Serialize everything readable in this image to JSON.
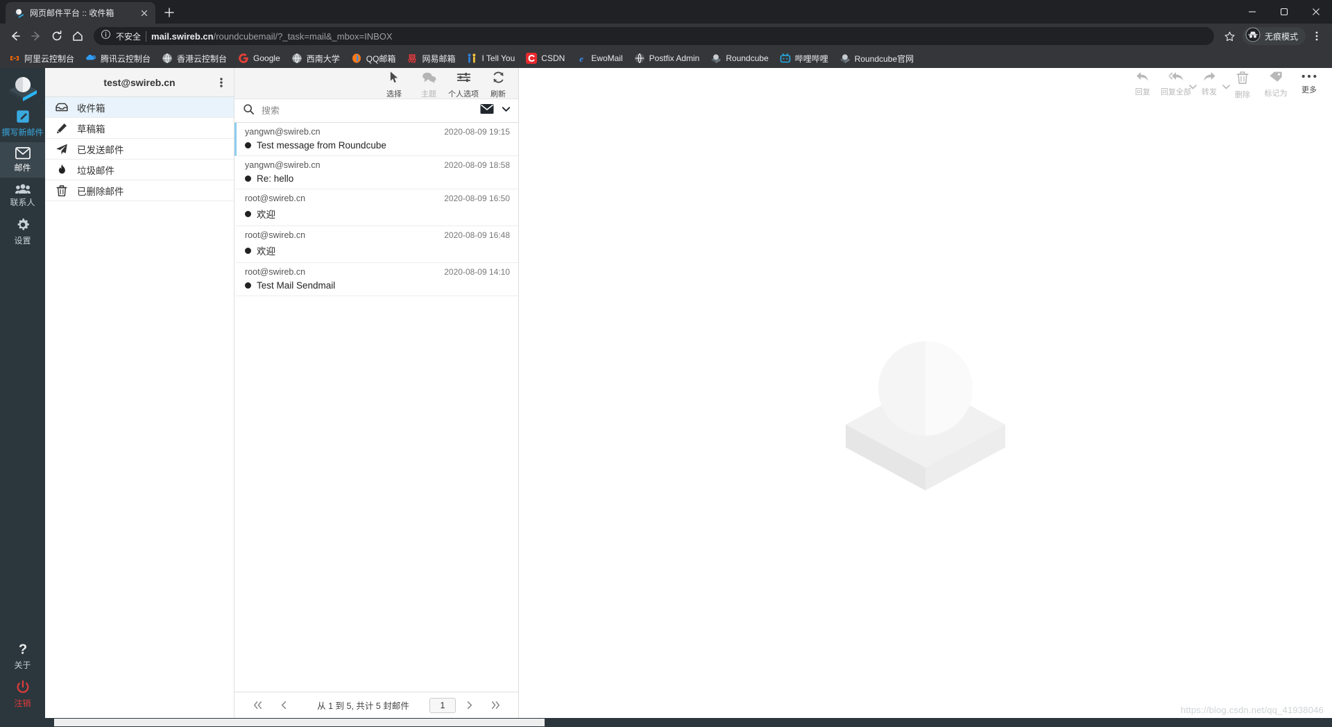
{
  "browser": {
    "tab": {
      "title": "网页邮件平台 :: 收件箱",
      "favicon": "roundcube-logo-icon",
      "close": "close-icon"
    },
    "newtab_label": "new-tab-icon",
    "window": {
      "minimize": "minimize-icon",
      "maximize": "maximize-icon",
      "close": "window-close-icon"
    },
    "nav": {
      "back": "back-arrow-icon",
      "forward": "forward-arrow-icon",
      "reload": "reload-icon",
      "home": "home-icon"
    },
    "omnibox": {
      "security_label": "不安全",
      "url_host": "mail.swireb.cn",
      "url_path": "/roundcubemail/?_task=mail&_mbox=INBOX",
      "star": "bookmark-star-icon"
    },
    "incognito": {
      "label": "无痕模式",
      "icon": "incognito-hat-icon"
    },
    "menu": "chrome-menu-icon",
    "bookmarks": [
      {
        "label": "阿里云控制台",
        "icon": "aliyun-icon",
        "color": "#ff6a00"
      },
      {
        "label": "腾讯云控制台",
        "icon": "tencent-cloud-icon",
        "color": "#2f9df5"
      },
      {
        "label": "香港云控制台",
        "icon": "globe-icon",
        "color": "#9aa0a6"
      },
      {
        "label": "Google",
        "icon": "google-icon",
        "color": "#e94235"
      },
      {
        "label": "西南大学",
        "icon": "globe-icon",
        "color": "#9aa0a6"
      },
      {
        "label": "QQ邮箱",
        "icon": "qqmail-icon",
        "color": "#ff7a18"
      },
      {
        "label": "网易邮箱",
        "icon": "netease-icon",
        "color": "#e4393c"
      },
      {
        "label": "I Tell You",
        "icon": "itellyou-icon",
        "color": "#f4c23a"
      },
      {
        "label": "CSDN",
        "icon": "csdn-icon",
        "color": "#e8292d"
      },
      {
        "label": "EwoMail",
        "icon": "ewomail-icon",
        "color": "#3d8bf2"
      },
      {
        "label": "Postfix Admin",
        "icon": "globe-icon",
        "color": "#555a5e"
      },
      {
        "label": "Roundcube",
        "icon": "roundcube-icon",
        "color": "#c7ccd1"
      },
      {
        "label": "哔哩哔哩",
        "icon": "bilibili-icon",
        "color": "#23ade5"
      },
      {
        "label": "Roundcube官网",
        "icon": "roundcube-icon",
        "color": "#c7ccd1"
      }
    ]
  },
  "rail": {
    "logo": "roundcube-logo-icon",
    "items": [
      {
        "label": "撰写新邮件",
        "icon": "compose-pencil-icon",
        "state": "compose"
      },
      {
        "label": "邮件",
        "icon": "envelope-icon",
        "state": "active"
      },
      {
        "label": "联系人",
        "icon": "contacts-icon",
        "state": ""
      },
      {
        "label": "设置",
        "icon": "gear-icon",
        "state": ""
      }
    ],
    "bottom": [
      {
        "label": "关于",
        "icon": "question-mark-icon",
        "state": ""
      },
      {
        "label": "注销",
        "icon": "power-icon",
        "state": "logout"
      }
    ]
  },
  "folders": {
    "account": "test@swireb.cn",
    "options_icon": "kebab-menu-icon",
    "items": [
      {
        "label": "收件箱",
        "icon": "inbox-icon",
        "selected": true
      },
      {
        "label": "草稿箱",
        "icon": "draft-pencil-icon",
        "selected": false
      },
      {
        "label": "已发送邮件",
        "icon": "sent-paperplane-icon",
        "selected": false
      },
      {
        "label": "垃圾邮件",
        "icon": "junk-fire-icon",
        "selected": false
      },
      {
        "label": "已删除邮件",
        "icon": "trash-icon",
        "selected": false
      }
    ]
  },
  "list_toolbar": [
    {
      "label": "选择",
      "icon": "cursor-arrow-icon",
      "disabled": false
    },
    {
      "label": "主题",
      "icon": "threads-bubbles-icon",
      "disabled": true
    },
    {
      "label": "个人选项",
      "icon": "sliders-icon",
      "disabled": false
    },
    {
      "label": "刷新",
      "icon": "refresh-icon",
      "disabled": false
    }
  ],
  "search": {
    "placeholder": "搜索",
    "icon": "search-icon",
    "scope_icon": "envelope-filled-icon",
    "chevron_icon": "chevron-down-icon"
  },
  "messages": [
    {
      "from": "yangwn@swireb.cn",
      "date": "2020-08-09 19:15",
      "subject": "Test message from Roundcube",
      "unread": true,
      "highlight": true
    },
    {
      "from": "yangwn@swireb.cn",
      "date": "2020-08-09 18:58",
      "subject": "Re: hello",
      "unread": true,
      "highlight": false
    },
    {
      "from": "root@swireb.cn",
      "date": "2020-08-09 16:50",
      "subject": "欢迎",
      "unread": true,
      "highlight": false
    },
    {
      "from": "root@swireb.cn",
      "date": "2020-08-09 16:48",
      "subject": "欢迎",
      "unread": true,
      "highlight": false
    },
    {
      "from": "root@swireb.cn",
      "date": "2020-08-09 14:10",
      "subject": "Test Mail Sendmail",
      "unread": true,
      "highlight": false
    }
  ],
  "pager": {
    "first_icon": "double-chevron-left-icon",
    "prev_icon": "chevron-left-icon",
    "summary": "从 1 到 5,  共计 5 封邮件",
    "page_value": "1",
    "next_icon": "chevron-right-icon",
    "last_icon": "double-chevron-right-icon"
  },
  "preview_toolbar": [
    {
      "label": "回复",
      "icon": "reply-icon",
      "caret": false
    },
    {
      "label": "回复全部",
      "icon": "reply-all-icon",
      "caret": true
    },
    {
      "label": "转发",
      "icon": "forward-icon",
      "caret": true
    },
    {
      "label": "删除",
      "icon": "trash-icon",
      "caret": false
    },
    {
      "label": "标记为",
      "icon": "tag-icon",
      "caret": false
    },
    {
      "label": "更多",
      "icon": "more-dots-icon",
      "caret": false,
      "active": true
    }
  ],
  "preview": {
    "placeholder_icon": "roundcube-watermark-icon",
    "watermark": "https://blog.csdn.net/qq_41938046"
  },
  "colors": {
    "rail_bg": "#2c373d",
    "accent_blue": "#3aa9e0",
    "logout_red": "#e23b3b",
    "selected_folder": "#e8f3fb",
    "unread_border": "#8ecdf0"
  }
}
